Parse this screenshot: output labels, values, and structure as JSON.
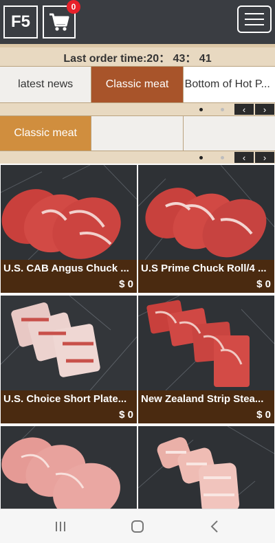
{
  "header": {
    "logo_text": "F5",
    "cart_count": "0"
  },
  "order_time": "Last order time:20： 43： 41",
  "category_tabs": [
    {
      "label": "latest news"
    },
    {
      "label": "Classic meat"
    },
    {
      "label": "Bottom of Hot P..."
    }
  ],
  "sub_tabs": [
    {
      "label": "Classic meat"
    },
    {
      "label": ""
    },
    {
      "label": ""
    }
  ],
  "pager": {
    "prev_label": "‹",
    "next_label": "›"
  },
  "products": [
    {
      "name": "U.S. CAB Angus Chuck ...",
      "price": "$ 0"
    },
    {
      "name": "U.S Prime Chuck Roll/4 ...",
      "price": "$ 0"
    },
    {
      "name": "U.S. Choice Short Plate...",
      "price": "$ 0"
    },
    {
      "name": "New Zealand Strip Stea...",
      "price": "$ 0"
    },
    {
      "name": "",
      "price": ""
    },
    {
      "name": "",
      "price": ""
    }
  ],
  "colors": {
    "header_bg": "#3a3d42",
    "active_tab": "#a8542a",
    "active_subtab": "#d08e3e",
    "card_bg": "#4a2a10",
    "badge": "#e8202a"
  },
  "icons": [
    "cart-icon",
    "menu-icon",
    "recent-apps-icon",
    "home-icon",
    "back-icon"
  ]
}
